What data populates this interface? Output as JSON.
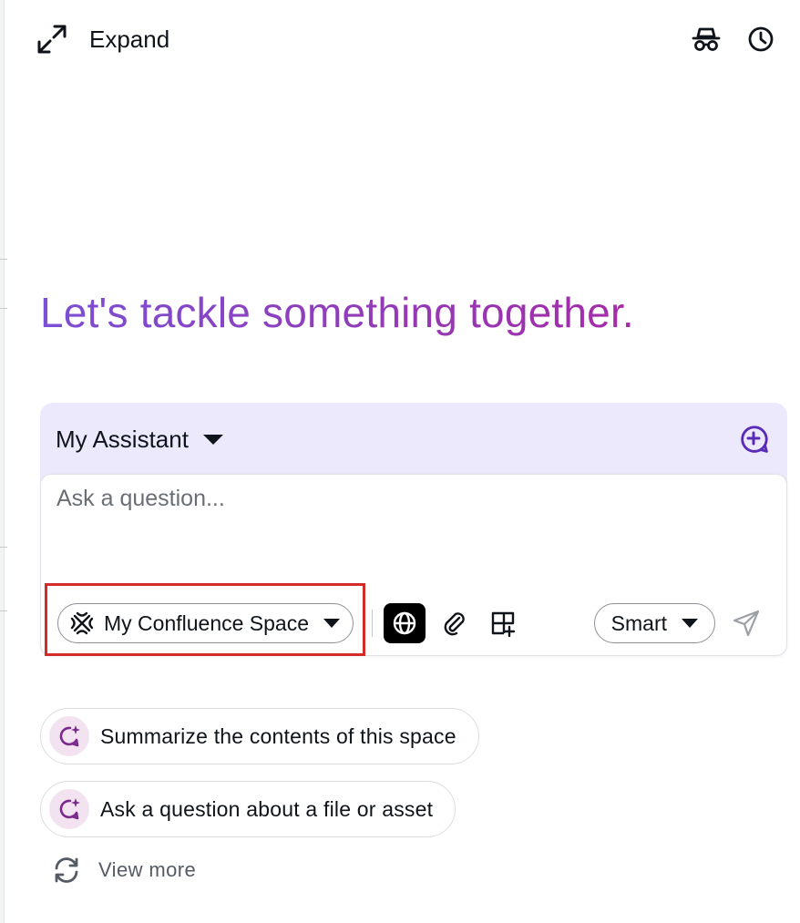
{
  "header": {
    "expand_label": "Expand",
    "icons": [
      "expand-icon",
      "incognito-icon",
      "history-icon"
    ]
  },
  "headline": "Let's tackle something together.",
  "assistant": {
    "name": "My Assistant",
    "new_chat_icon": "new-chat-icon",
    "input": {
      "placeholder": "Ask a question...",
      "value": ""
    },
    "toolbar": {
      "space_label": "My Confluence Space",
      "space_icon": "confluence-space-icon",
      "web_search_icon": "globe-icon",
      "attach_icon": "paperclip-icon",
      "add_widget_icon": "add-grid-icon",
      "mode_label": "Smart",
      "send_icon": "send-icon"
    }
  },
  "suggestions": [
    {
      "label": "Summarize the contents of this space",
      "icon": "ai-chat-icon"
    },
    {
      "label": "Ask a question about a file or asset",
      "icon": "ai-chat-icon"
    }
  ],
  "view_more_label": "View more",
  "colors": {
    "accent_purple": "#5a2ab8",
    "headline_start": "#7b4fd6",
    "headline_end": "#a52ba8",
    "card_bg": "#ece9fc",
    "highlight_red": "#d32a2a",
    "suggestion_icon": "#7a2a8c"
  }
}
